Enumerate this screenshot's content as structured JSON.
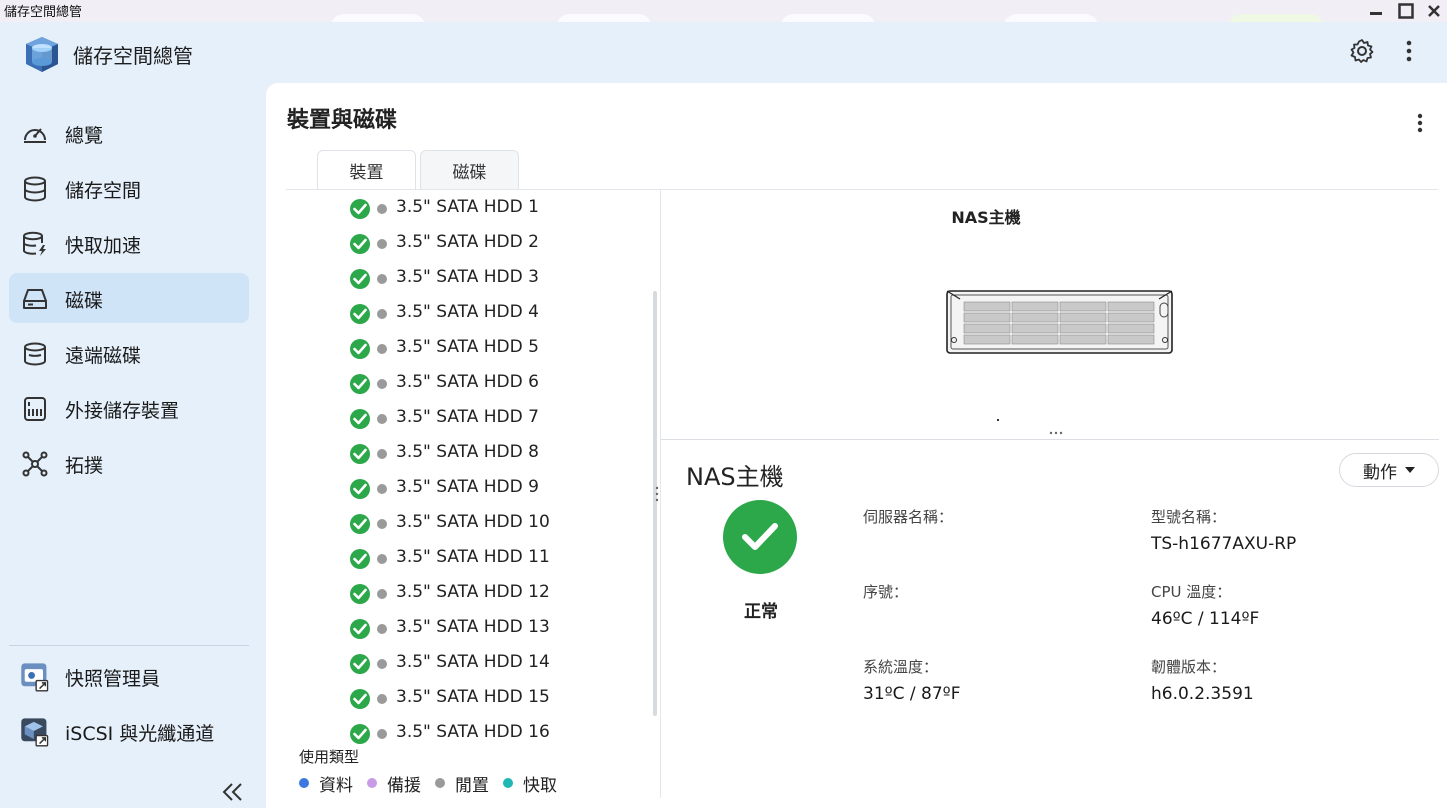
{
  "window": {
    "title": "儲存空間總管"
  },
  "app": {
    "title": "儲存空間總管"
  },
  "sidebar": {
    "items": [
      {
        "label": "總覽",
        "icon": "speedometer-icon"
      },
      {
        "label": "儲存空間",
        "icon": "database-icon"
      },
      {
        "label": "快取加速",
        "icon": "cache-acceleration-icon"
      },
      {
        "label": "磁碟",
        "icon": "disk-icon",
        "active": true
      },
      {
        "label": "遠端磁碟",
        "icon": "remote-disk-icon"
      },
      {
        "label": "外接儲存裝置",
        "icon": "external-storage-icon"
      },
      {
        "label": "拓撲",
        "icon": "topology-icon"
      }
    ],
    "apps": [
      {
        "label": "快照管理員",
        "icon": "snapshot-manager-icon"
      },
      {
        "label": "iSCSI 與光纖通道",
        "icon": "iscsi-icon"
      }
    ]
  },
  "main": {
    "title": "裝置與磁碟",
    "tabs": [
      {
        "label": "裝置",
        "active": true
      },
      {
        "label": "磁碟",
        "active": false
      }
    ],
    "disks": [
      "3.5\" SATA HDD 1",
      "3.5\" SATA HDD 2",
      "3.5\" SATA HDD 3",
      "3.5\" SATA HDD 4",
      "3.5\" SATA HDD 5",
      "3.5\" SATA HDD 6",
      "3.5\" SATA HDD 7",
      "3.5\" SATA HDD 8",
      "3.5\" SATA HDD 9",
      "3.5\" SATA HDD 10",
      "3.5\" SATA HDD 11",
      "3.5\" SATA HDD 12",
      "3.5\" SATA HDD 13",
      "3.5\" SATA HDD 14",
      "3.5\" SATA HDD 15",
      "3.5\" SATA HDD 16"
    ],
    "legend": {
      "title": "使用類型",
      "items": [
        {
          "label": "資料",
          "color": "#3b78e0"
        },
        {
          "label": "備援",
          "color": "#c79be6"
        },
        {
          "label": "閒置",
          "color": "#9a9a9a"
        },
        {
          "label": "快取",
          "color": "#1fb7b3"
        }
      ]
    },
    "device_view": {
      "title": "NAS主機"
    },
    "detail": {
      "title": "NAS主機",
      "action_label": "動作",
      "status": "正常",
      "fields": {
        "server_name_label": "伺服器名稱：",
        "server_name_value": "",
        "model_label": "型號名稱：",
        "model_value": "TS-h1677AXU-RP",
        "serial_label": "序號：",
        "serial_value": "",
        "cpu_temp_label": "CPU 溫度：",
        "cpu_temp_value": "46ºC / 114ºF",
        "sys_temp_label": "系統溫度：",
        "sys_temp_value": "31ºC / 87ºF",
        "firmware_label": "韌體版本：",
        "firmware_value": "h6.0.2.3591"
      }
    }
  },
  "colors": {
    "ok_green": "#2ca84a",
    "active_nav": "#d0e4f8",
    "sidebar_bg": "#e6f0fb"
  }
}
